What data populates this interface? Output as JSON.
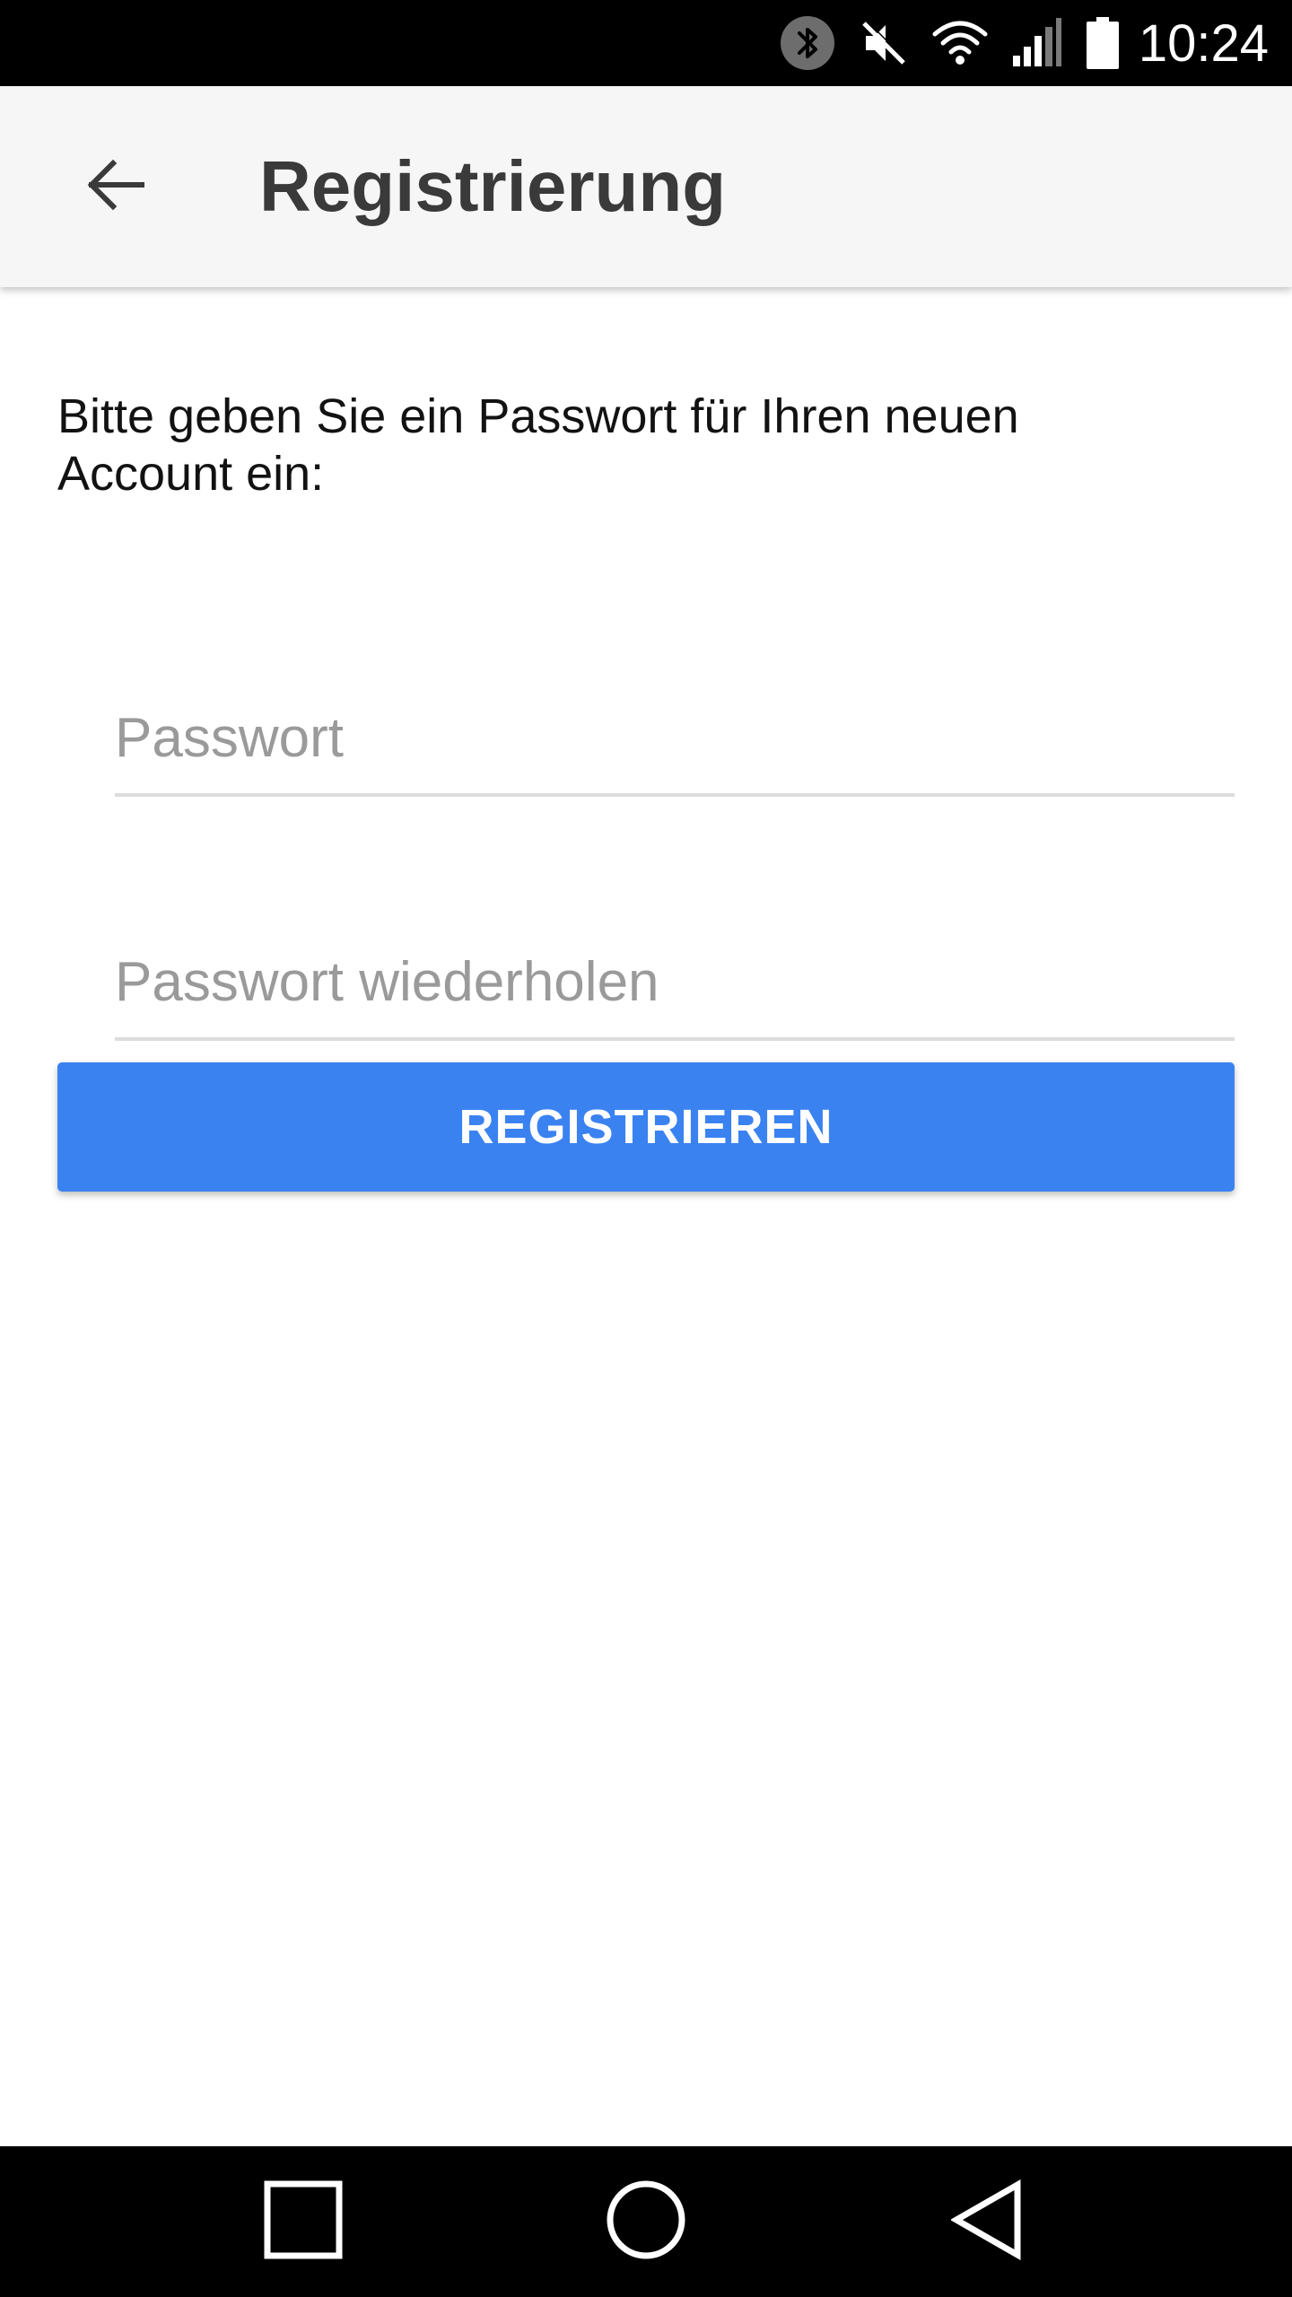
{
  "status_bar": {
    "time": "10:24",
    "icons": [
      "bluetooth-icon",
      "mute-icon",
      "wifi-icon",
      "signal-icon",
      "battery-icon"
    ]
  },
  "app_bar": {
    "back_icon": "arrow-back-icon",
    "title": "Registrierung"
  },
  "form": {
    "instruction": "Bitte geben Sie ein Passwort für Ihren neuen Account ein:",
    "password": {
      "value": "",
      "placeholder": "Passwort"
    },
    "password_repeat": {
      "value": "",
      "placeholder": "Passwort wiederholen"
    },
    "register_label": "REGISTRIEREN"
  },
  "nav_bar": {
    "icons": [
      "recents-square-icon",
      "home-circle-icon",
      "back-triangle-icon"
    ]
  },
  "colors": {
    "status_bar_bg": "#000000",
    "app_bar_bg": "#f6f6f6",
    "title_text": "#3a3a3a",
    "accent": "#3b82f1",
    "placeholder": "#9a9a9a",
    "underline": "#dcdcdc"
  }
}
